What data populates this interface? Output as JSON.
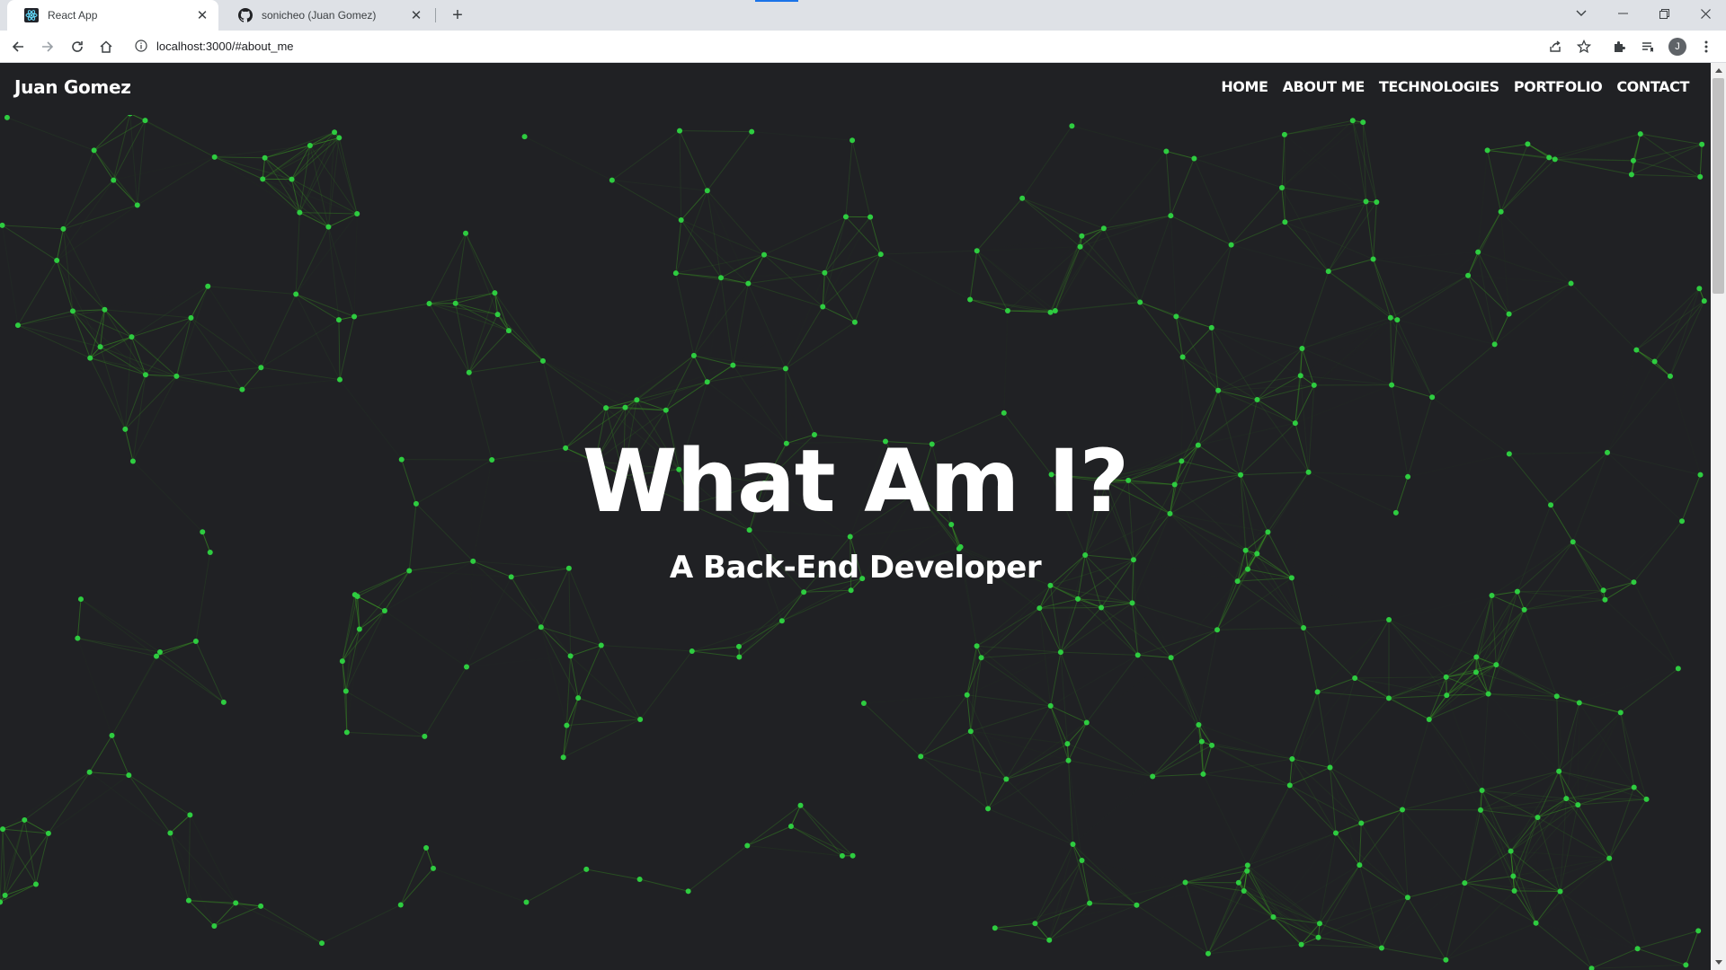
{
  "browser": {
    "tabs": [
      {
        "title": "React App",
        "favicon": "react-icon",
        "active": true
      },
      {
        "title": "sonicheo (Juan Gomez)",
        "favicon": "github-icon",
        "active": false
      }
    ],
    "url": "localhost:3000/#about_me",
    "profile_initial": "J"
  },
  "page": {
    "brand": "Juan Gomez",
    "nav": [
      "HOME",
      "ABOUT ME",
      "TECHNOLOGIES",
      "PORTFOLIO",
      "CONTACT"
    ],
    "hero_title": "What Am I?",
    "hero_subtitle": "A Back-End Developer"
  },
  "colors": {
    "background": "#202124",
    "network_node": "#2ecc40",
    "network_line": "#3a9d23",
    "text": "#ffffff"
  }
}
